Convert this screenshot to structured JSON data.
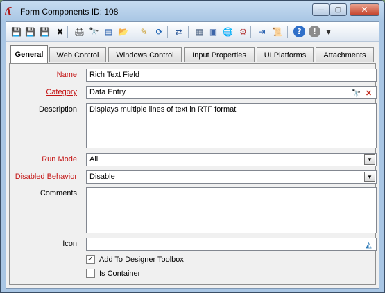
{
  "window": {
    "title": "Form Components ID: 108",
    "min_glyph": "—",
    "max_glyph": "▢",
    "close_glyph": "✕"
  },
  "toolbar": {
    "buttons": [
      {
        "name": "save-icon",
        "glyph": "💾",
        "color": "#1f4fa3"
      },
      {
        "name": "save-close-icon",
        "glyph": "💾",
        "color": "#b02020"
      },
      {
        "name": "save-as-icon",
        "glyph": "💾",
        "color": "#4b5fa8"
      },
      {
        "name": "delete-icon",
        "glyph": "✖",
        "color": "#111111"
      },
      {
        "name": "print-icon",
        "glyph": "🖨",
        "color": "#444444"
      },
      {
        "name": "find-icon",
        "glyph": "🔭",
        "color": "#2a3d6b"
      },
      {
        "name": "copy-icon",
        "glyph": "▤",
        "color": "#3b6db3"
      },
      {
        "name": "folder-icon",
        "glyph": "📂",
        "color": "#d6a21b"
      },
      {
        "name": "notes-icon",
        "glyph": "✎",
        "color": "#c7951a"
      },
      {
        "name": "refresh-icon",
        "glyph": "⟳",
        "color": "#1e64b4"
      },
      {
        "name": "link-icon",
        "glyph": "⇄",
        "color": "#2b5797"
      },
      {
        "name": "components-icon",
        "glyph": "▦",
        "color": "#5a6f8c"
      },
      {
        "name": "layout-icon",
        "glyph": "▣",
        "color": "#3c65a8"
      },
      {
        "name": "globe-icon",
        "glyph": "🌐",
        "color": "#2e8b3a"
      },
      {
        "name": "gear-icon",
        "glyph": "⚙",
        "color": "#b23a3a"
      },
      {
        "name": "import-icon",
        "glyph": "⇥",
        "color": "#2860b0"
      },
      {
        "name": "script-icon",
        "glyph": "📜",
        "color": "#6a6a6a"
      },
      {
        "name": "help-icon",
        "glyph": "?",
        "color": "#ffffff"
      },
      {
        "name": "stop-icon",
        "glyph": "!",
        "color": "#ffffff"
      },
      {
        "name": "overflow-icon",
        "glyph": "▾",
        "color": "#333333"
      }
    ]
  },
  "tabs": [
    {
      "label": "General",
      "active": true
    },
    {
      "label": "Web Control",
      "active": false
    },
    {
      "label": "Windows Control",
      "active": false
    },
    {
      "label": "Input Properties",
      "active": false
    },
    {
      "label": "UI Platforms",
      "active": false
    },
    {
      "label": "Attachments",
      "active": false
    }
  ],
  "form": {
    "name_label": "Name",
    "name_value": "Rich Text Field",
    "category_label": "Category",
    "category_value": "Data Entry",
    "description_label": "Description",
    "description_value": "Displays multiple lines of text in RTF format",
    "run_mode_label": "Run Mode",
    "run_mode_value": "All",
    "disabled_behavior_label": "Disabled Behavior",
    "disabled_behavior_value": "Disable",
    "comments_label": "Comments",
    "comments_value": "",
    "icon_label": "Icon",
    "icon_value": "",
    "add_toolbox_label": "Add To Designer Toolbox",
    "add_toolbox_checked": true,
    "is_container_label": "Is Container",
    "is_container_checked": false
  },
  "colors": {
    "required_label": "#c41515",
    "title_bar": "#a9c6e4"
  }
}
